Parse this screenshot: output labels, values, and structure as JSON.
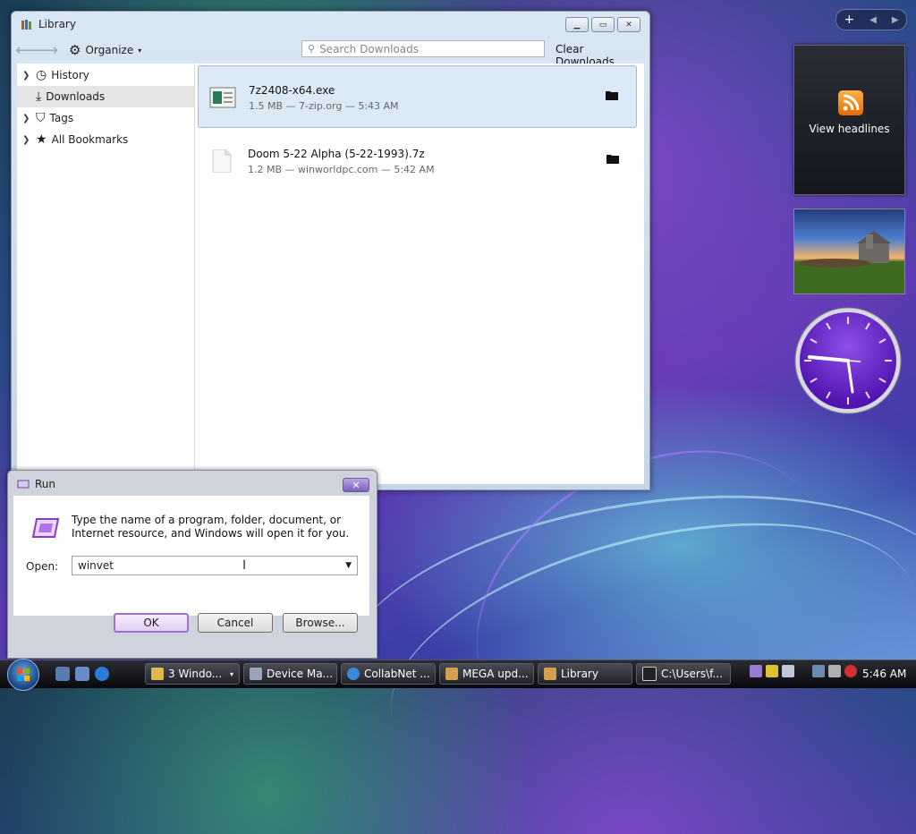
{
  "library": {
    "title": "Library",
    "toolbar": {
      "organize": "Organize",
      "search_placeholder": "Search Downloads",
      "clear_downloads": "Clear Downloads"
    },
    "sidebar": [
      {
        "label": "History",
        "icon": "clock-icon",
        "expandable": true
      },
      {
        "label": "Downloads",
        "icon": "download-icon",
        "expandable": false,
        "selected": true
      },
      {
        "label": "Tags",
        "icon": "tag-icon",
        "expandable": true
      },
      {
        "label": "All Bookmarks",
        "icon": "star-icon",
        "expandable": true
      }
    ],
    "downloads": [
      {
        "name": "7z2408-x64.exe",
        "meta": "1.5 MB — 7-zip.org — 5:43 AM",
        "selected": true
      },
      {
        "name": "Doom 5-22 Alpha (5-22-1993).7z",
        "meta": "1.2 MB — winworldpc.com — 5:42 AM",
        "selected": false
      }
    ]
  },
  "gadgets": {
    "feed_label": "View headlines",
    "clock_time": "5:46"
  },
  "run": {
    "title": "Run",
    "description": "Type the name of a program, folder, document, or Internet resource, and Windows will open it for you.",
    "open_label": "Open:",
    "input_value": "winvet",
    "buttons": {
      "ok": "OK",
      "cancel": "Cancel",
      "browse": "Browse..."
    }
  },
  "taskbar": {
    "tasks": [
      {
        "label": "3 Windo...",
        "color": "#e0b84a"
      },
      {
        "label": "Device Ma...",
        "color": "#9aa6b8"
      },
      {
        "label": "CollabNet ...",
        "color": "#3a8ad8"
      },
      {
        "label": "MEGA upd...",
        "color": "#d4a050"
      },
      {
        "label": "Library",
        "color": "#d4a050"
      },
      {
        "label": "C:\\Users\\f...",
        "color": "#222222"
      }
    ],
    "time": "5:46 AM"
  }
}
